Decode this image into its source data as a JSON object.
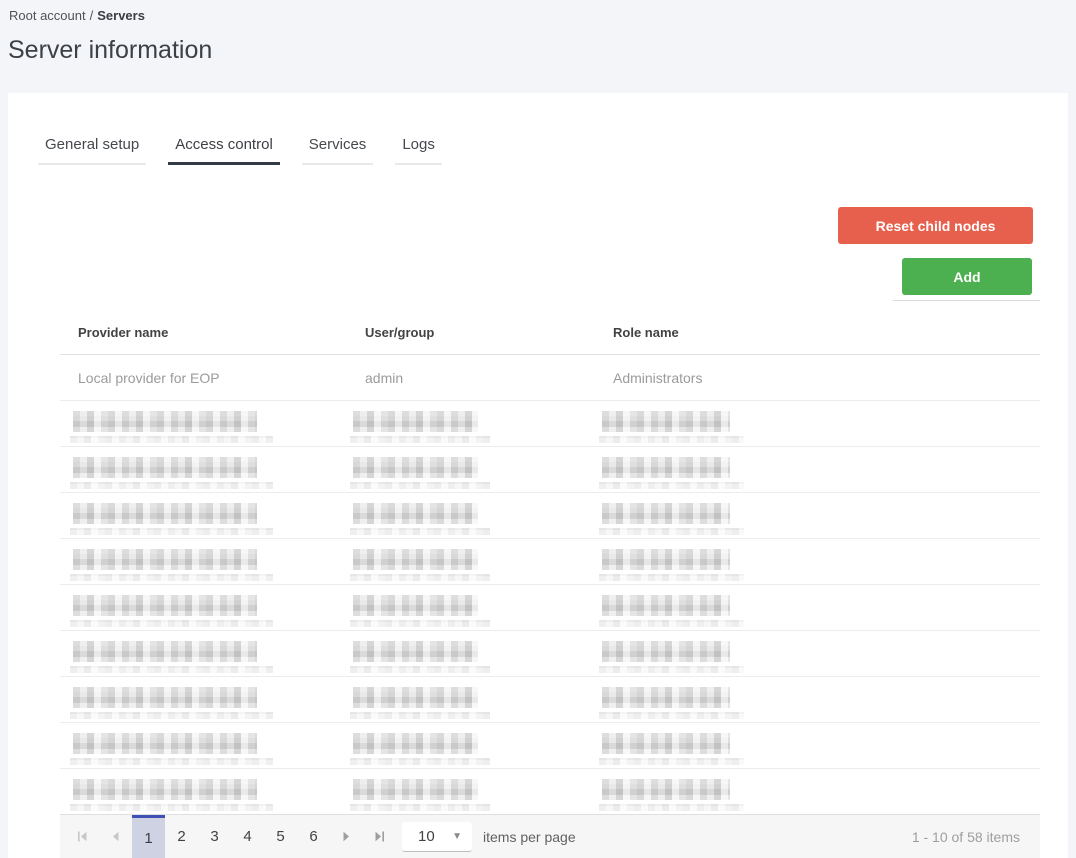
{
  "breadcrumb": {
    "root": "Root account",
    "separator": "/",
    "current": "Servers"
  },
  "page": {
    "title": "Server information"
  },
  "tabs": [
    {
      "label": "General setup",
      "active": false
    },
    {
      "label": "Access control",
      "active": true
    },
    {
      "label": "Services",
      "active": false
    },
    {
      "label": "Logs",
      "active": false
    }
  ],
  "actions": {
    "reset_button": "Reset child nodes",
    "add_button": "Add"
  },
  "table": {
    "columns": [
      "Provider name",
      "User/group",
      "Role name"
    ],
    "rows": [
      {
        "provider": "Local provider for EOP",
        "user_group": "admin",
        "role": "Administrators"
      }
    ],
    "redacted_rows": 9
  },
  "pagination": {
    "pages": [
      "1",
      "2",
      "3",
      "4",
      "5",
      "6"
    ],
    "current_page": "1",
    "page_size": "10",
    "page_size_label": "items per page",
    "summary": "1 - 10 of 58 items"
  },
  "colors": {
    "danger_button": "#e7604e",
    "success_button": "#4caf50",
    "pager_selected_accent": "#3f51b5",
    "pager_selected_bg": "#ced2e2",
    "page_background": "#f4f5f8"
  }
}
